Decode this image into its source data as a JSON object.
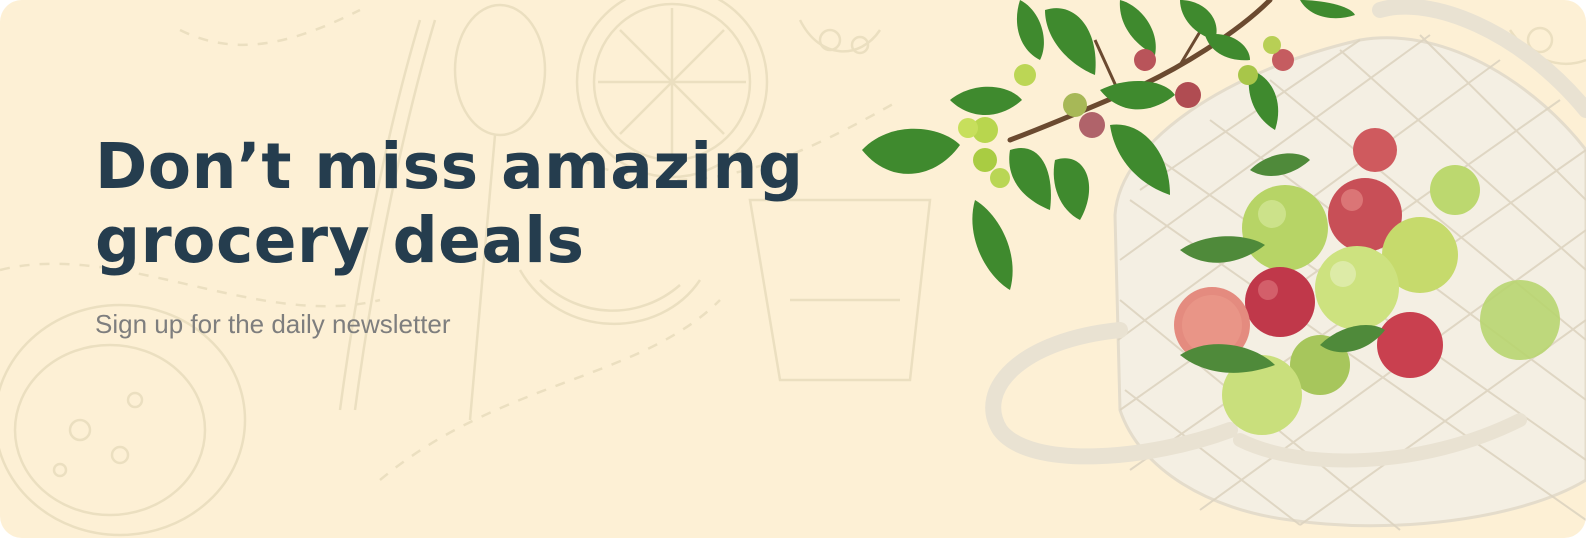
{
  "banner": {
    "headline": "Don’t miss amazing grocery deals",
    "subtitle": "Sign up for the daily newsletter",
    "hero_image": "apples-in-mesh-bag"
  },
  "colors": {
    "background": "#fdf0d5",
    "headline": "#253d4e",
    "subtitle": "#7e7e7e",
    "doodle": "#ece0c2"
  }
}
